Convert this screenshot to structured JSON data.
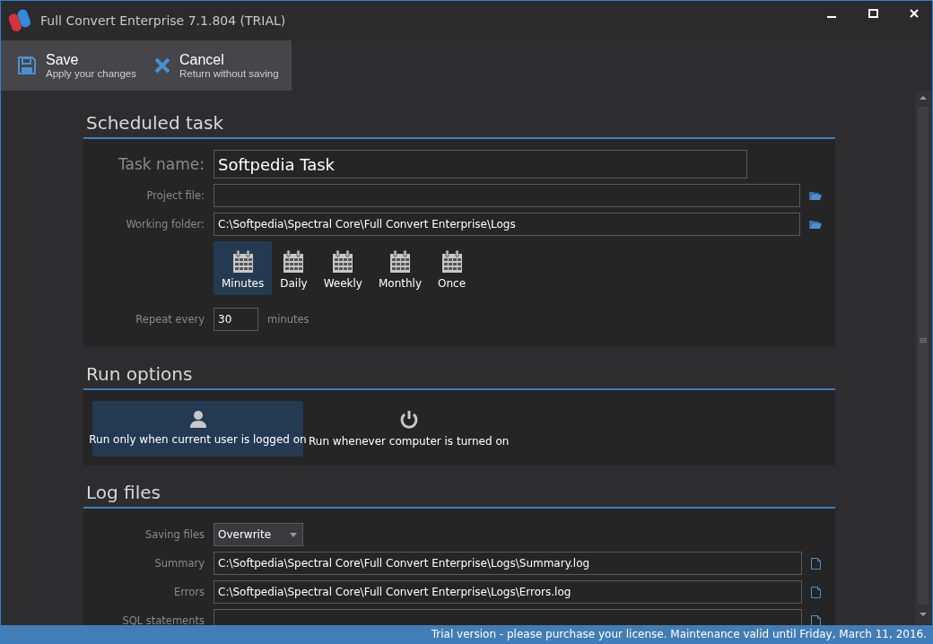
{
  "window": {
    "title": "Full Convert Enterprise 7.1.804 (TRIAL)"
  },
  "toolbar": [
    {
      "kind": "save",
      "label": "Save",
      "sublabel": "Apply your changes"
    },
    {
      "kind": "cancel",
      "label": "Cancel",
      "sublabel": "Return without saving"
    }
  ],
  "scheduled_task": {
    "title": "Scheduled task",
    "task_name_label": "Task name:",
    "task_name": "Softpedia Task",
    "project_file_label": "Project file:",
    "working_folder_label": "Working folder:",
    "working_folder": "C:\\Softpedia\\Spectral Core\\Full Convert Enterprise\\Logs",
    "schedule": [
      {
        "label": "Minutes",
        "selected": true
      },
      {
        "label": "Daily",
        "selected": false
      },
      {
        "label": "Weekly",
        "selected": false
      },
      {
        "label": "Monthly",
        "selected": false
      },
      {
        "label": "Once",
        "selected": false
      }
    ],
    "repeat_label": "Repeat every",
    "repeat_value": "30",
    "repeat_unit": "minutes"
  },
  "run_options": {
    "title": "Run options",
    "options": [
      {
        "kind": "user",
        "label": "Run only when current user is logged on",
        "selected": true
      },
      {
        "kind": "power",
        "label": "Run whenever computer is turned on",
        "selected": false
      }
    ]
  },
  "log_files": {
    "title": "Log files",
    "saving_files_label": "Saving files",
    "saving_files": "Overwrite",
    "files": [
      {
        "label": "Summary",
        "value": "C:\\Softpedia\\Spectral Core\\Full Convert Enterprise\\Logs\\Summary.log"
      },
      {
        "label": "Errors",
        "value": "C:\\Softpedia\\Spectral Core\\Full Convert Enterprise\\Logs\\Errors.log"
      },
      {
        "label": "SQL statements"
      }
    ]
  },
  "status_bar": "Trial version - please purchase your license. Maintenance valid until Friday, March 11, 2016."
}
